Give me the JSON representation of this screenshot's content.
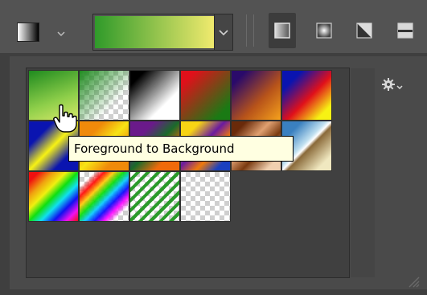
{
  "toolbar": {
    "gradient_thumb_colors": [
      "#ffffff",
      "#000000"
    ],
    "picker_gradient": [
      "#2f9a2a",
      "#f0ea6e"
    ],
    "modes": [
      "linear",
      "radial",
      "angle",
      "reflected"
    ],
    "active_mode": "linear"
  },
  "panel": {
    "tooltip": "Foreground to Background",
    "gear_icon": "gear-icon",
    "accent": "#4a4a4a"
  },
  "swatches": [
    {
      "name": "foreground-to-background"
    },
    {
      "name": "foreground-to-transparent"
    },
    {
      "name": "black-white"
    },
    {
      "name": "red-green"
    },
    {
      "name": "violet-orange"
    },
    {
      "name": "blue-red-yellow"
    },
    {
      "name": "blue-yellow-blue"
    },
    {
      "name": "orange-yellow-orange"
    },
    {
      "name": "violet-green-orange"
    },
    {
      "name": "yellow-violet-orange-blue"
    },
    {
      "name": "copper"
    },
    {
      "name": "chrome"
    },
    {
      "name": "spectrum"
    },
    {
      "name": "transparent-rainbow"
    },
    {
      "name": "transparent-stripes"
    },
    {
      "name": "transparent"
    }
  ]
}
